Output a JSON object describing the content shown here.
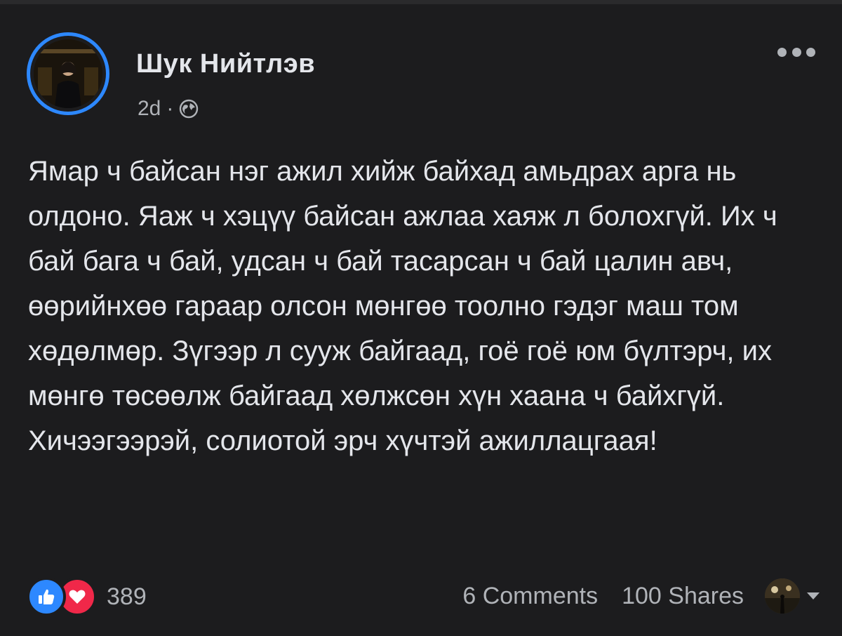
{
  "post": {
    "author": "Шук Нийтлэв",
    "time": "2d",
    "separator": "·",
    "audience_icon": "globe-icon",
    "menu_icon": "more-icon",
    "text": "Ямар ч байсан нэг ажил хийж байхад амьдрах арга нь олдоно. Яаж ч хэцүү байсан ажлаа хаяж л болохгүй. Их ч бай бага ч бай, удсан ч бай тасарсан ч бай цалин авч, өөрийнхөө гараар олсон мөнгөө тоолно гэдэг маш том хөдөлмөр. Зүгээр л сууж байгаад, гоё гоё юм бүлтэрч, их мөнгө төсөөлж байгаад хөлжсөн хүн хаана ч байхгүй. Хичээгээрэй, солиотой эрч хүчтэй ажиллацгаая!"
  },
  "footer": {
    "reactions": [
      "like-icon",
      "love-icon"
    ],
    "reaction_count": "389",
    "comments": "6 Comments",
    "shares": "100 Shares"
  },
  "colors": {
    "background": "#1c1c1e",
    "text": "#e4e6eb",
    "secondary": "#b0b3b8",
    "accent": "#2d88ff",
    "love": "#f02849"
  }
}
